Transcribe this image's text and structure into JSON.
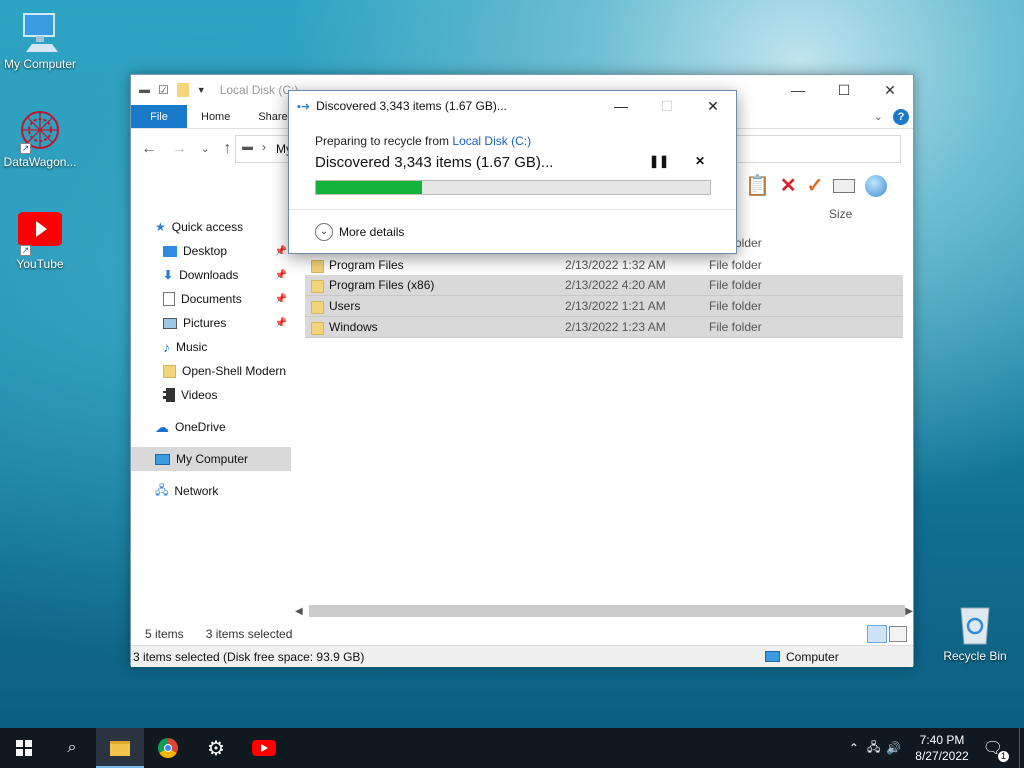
{
  "desktop": {
    "icons": [
      {
        "label": "My Computer"
      },
      {
        "label": "DataWagon..."
      },
      {
        "label": "YouTube"
      },
      {
        "label": "Recycle Bin"
      }
    ]
  },
  "explorer": {
    "title": "Local Disk (C:)",
    "tabs": [
      "File",
      "Home",
      "Share"
    ],
    "address_text": "My",
    "column_size": "Size",
    "nav": {
      "quick_access": "Quick access",
      "items": [
        "Desktop",
        "Downloads",
        "Documents",
        "Pictures",
        "Music",
        "Open-Shell Modern",
        "Videos"
      ],
      "onedrive": "OneDrive",
      "my_computer": "My Computer",
      "network": "Network"
    },
    "partial_type": "older",
    "files": [
      {
        "name": "Program Files",
        "date": "2/13/2022 1:32 AM",
        "type": "File folder"
      },
      {
        "name": "Program Files (x86)",
        "date": "2/13/2022 4:20 AM",
        "type": "File folder"
      },
      {
        "name": "Users",
        "date": "2/13/2022 1:21 AM",
        "type": "File folder"
      },
      {
        "name": "Windows",
        "date": "2/13/2022 1:23 AM",
        "type": "File folder"
      }
    ],
    "status_count": "5 items",
    "status_selected": "3 items selected",
    "status_bar": "3 items selected (Disk free space: 93.9 GB)",
    "status_location": "Computer"
  },
  "dialog": {
    "title": "Discovered 3,343 items (1.67 GB)...",
    "preparing_prefix": "Preparing to recycle from",
    "source_link": "Local Disk (C:)",
    "discovered": "Discovered 3,343 items (1.67 GB)...",
    "progress_percent": 27,
    "more_details": "More details"
  },
  "taskbar": {
    "time": "7:40 PM",
    "date": "8/27/2022",
    "notification_count": "1"
  },
  "colors": {
    "accent": "#1979ca",
    "progress": "#14b43a",
    "link": "#1a63b8"
  }
}
